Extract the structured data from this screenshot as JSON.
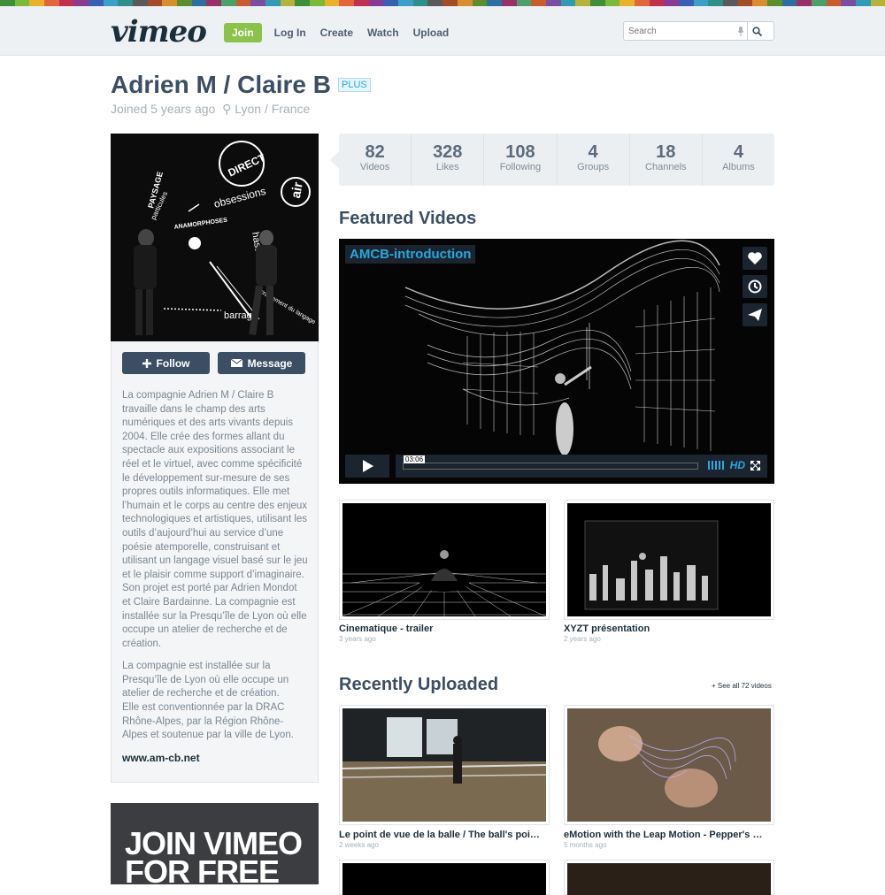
{
  "header": {
    "logo": "vimeo",
    "join_label": "Join",
    "nav": [
      "Log In",
      "Create",
      "Watch",
      "Upload"
    ],
    "search_placeholder": "Search"
  },
  "profile": {
    "name": "Adrien M / Claire B",
    "badge": "PLUS",
    "joined": "Joined 5 years ago",
    "location": "Lyon / France",
    "follow_label": "Follow",
    "message_label": "Message",
    "bio_1": "La compagnie Adrien M / Claire B travaille dans le champ des arts numériques et des arts vivants depuis 2004. Elle crée des formes allant du spectacle aux expositions associant le réel et le virtuel, avec comme spécificité le développement sur-mesure de ses propres outils informatiques. Elle met l’humain et le corps au centre des enjeux technologiques et artistiques, utilisant les outils d’aujourd’hui au service d’une poésie atemporelle, construisant et utilisant un langage visuel basé sur le jeu et le plaisir comme support d’imaginaire. Son projet est porté par Adrien Mondot et Claire Bardainne. La compagnie est installée sur la Presqu’île de Lyon où elle occupe un atelier de recherche et de création.",
    "bio_2": "La compagnie est installée sur la Presqu’île de Lyon où elle occupe un atelier de recherche et de création.",
    "bio_3": "Elle est conventionnée par la DRAC Rhône-Alpes, par la Région Rhône-Alpes et soutenue par la ville de Lyon.",
    "website": "www.am-cb.net",
    "image_words": [
      "DIRECT",
      "PAYSAGE",
      "particules",
      "obsessions",
      "air",
      "ANAMORPHOSES",
      "hasard",
      "barrage",
      "ecroulement du langage"
    ]
  },
  "ad": {
    "line1": "JOIN VIMEO",
    "line2": "FOR FREE"
  },
  "stats": [
    {
      "value": "82",
      "label": "Videos"
    },
    {
      "value": "328",
      "label": "Likes"
    },
    {
      "value": "108",
      "label": "Following"
    },
    {
      "value": "4",
      "label": "Groups"
    },
    {
      "value": "18",
      "label": "Channels"
    },
    {
      "value": "4",
      "label": "Albums"
    }
  ],
  "featured": {
    "heading": "Featured Videos",
    "player_title": "AMCB-introduction",
    "time": "03:06",
    "hd": "HD",
    "videos": [
      {
        "title": "Cinematique - trailer",
        "ago": "3 years ago"
      },
      {
        "title": "XYZT présentation",
        "ago": "2 years ago"
      }
    ]
  },
  "recent": {
    "heading": "Recently Uploaded",
    "see_all": "+ See all 72 videos",
    "videos": [
      {
        "title": "Le point de vue de la balle / The ball's poi…",
        "ago": "2 weeks ago"
      },
      {
        "title": "eMotion with the Leap Motion - Pepper's …",
        "ago": "5 months ago"
      }
    ]
  },
  "colors": {
    "accent": "#2aa7dd",
    "join": "#8bc34a",
    "dark": "#3b4e63"
  }
}
